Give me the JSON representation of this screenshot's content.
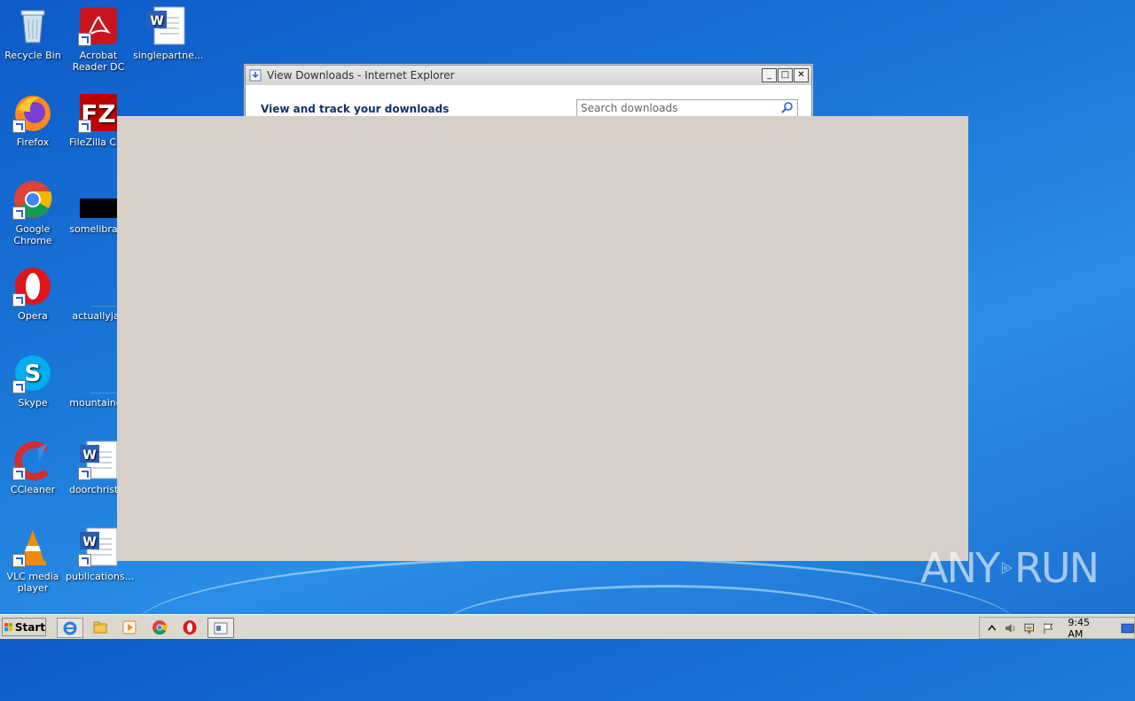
{
  "desktop": {
    "icons": [
      {
        "label": "Recycle Bin",
        "icon": "recycle-bin-icon"
      },
      {
        "label": "Acrobat Reader DC",
        "icon": "acrobat-icon"
      },
      {
        "label": "singlepartne...",
        "icon": "word-doc-icon"
      },
      {
        "label": "Firefox",
        "icon": "firefox-icon"
      },
      {
        "label": "FileZilla Clie",
        "icon": "filezilla-icon"
      },
      {
        "label": "Google Chrome",
        "icon": "chrome-icon"
      },
      {
        "label": "somelibrary",
        "icon": "black-file-icon"
      },
      {
        "label": "Opera",
        "icon": "opera-icon"
      },
      {
        "label": "actuallyjac",
        "icon": "blank-file-icon"
      },
      {
        "label": "Skype",
        "icon": "skype-icon"
      },
      {
        "label": "mountainch",
        "icon": "blank-file-icon"
      },
      {
        "label": "CCleaner",
        "icon": "ccleaner-icon"
      },
      {
        "label": "doorchristm",
        "icon": "word-doc-icon"
      },
      {
        "label": "VLC media player",
        "icon": "vlc-icon"
      },
      {
        "label": "publications...",
        "icon": "word-doc-icon"
      }
    ]
  },
  "window": {
    "title": "View Downloads - Internet Explorer",
    "heading": "View and track your downloads",
    "search_placeholder": "Search downloads",
    "buttons": {
      "minimize": "_",
      "maximize": "□",
      "close": "✕"
    }
  },
  "taskbar": {
    "start_label": "Start",
    "pinned": [
      "ie-icon",
      "explorer-icon",
      "media-player-icon",
      "chrome-icon",
      "opera-icon",
      "downloads-window-icon"
    ],
    "clock": "9:45 AM"
  },
  "watermark": {
    "left": "ANY",
    "right": "RUN"
  },
  "colors": {
    "overlay": "#d6d0c8",
    "desktop": "#1a78d8",
    "taskbar": "#dcd8d0"
  }
}
